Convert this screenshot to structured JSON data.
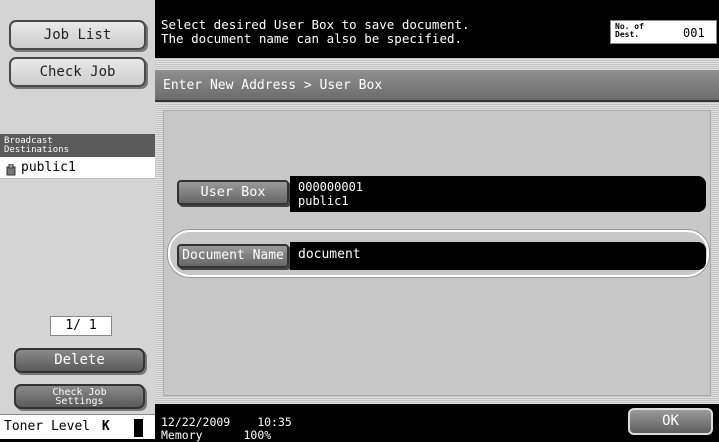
{
  "left_panel": {
    "job_list_label": "Job List",
    "check_job_label": "Check Job",
    "broadcast_title_line1": "Broadcast",
    "broadcast_title_line2": "Destinations",
    "destinations": [
      "public1"
    ],
    "page_indicator": "1/ 1",
    "delete_label": "Delete",
    "check_job_settings_line1": "Check Job",
    "check_job_settings_line2": "Settings",
    "toner_label": "Toner Level",
    "toner_color": "K"
  },
  "header": {
    "message_line1": "Select desired User Box to save document.",
    "message_line2": "The document name can also be specified.",
    "dest_label_line1": "No. of",
    "dest_label_line2": "Dest.",
    "dest_count": "001"
  },
  "breadcrumb": "Enter New Address > User Box",
  "form": {
    "user_box_label": "User Box",
    "user_box_number": "000000001",
    "user_box_name": "public1",
    "document_name_label": "Document Name",
    "document_name_value": "document"
  },
  "footer": {
    "date": "12/22/2009",
    "time": "10:35",
    "memory_label": "Memory",
    "memory_value": "100%",
    "ok_label": "OK"
  }
}
